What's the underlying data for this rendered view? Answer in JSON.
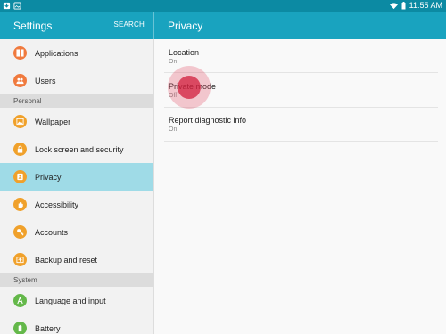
{
  "status_bar": {
    "time": "11:55 AM",
    "icons": [
      "download-icon",
      "image-icon",
      "wifi-icon",
      "battery-icon"
    ]
  },
  "header": {
    "title": "Settings",
    "search_label": "SEARCH",
    "detail_title": "Privacy"
  },
  "sidebar": {
    "items": [
      {
        "label": "Applications",
        "icon": "apps-icon",
        "color": "#f07a3e"
      },
      {
        "label": "Users",
        "icon": "users-icon",
        "color": "#f07a3e"
      }
    ],
    "personal_label": "Personal",
    "personal_items": [
      {
        "label": "Wallpaper",
        "icon": "wallpaper-icon",
        "color": "#f0a12b"
      },
      {
        "label": "Lock screen and security",
        "icon": "lock-icon",
        "color": "#f0a12b"
      },
      {
        "label": "Privacy",
        "icon": "privacy-icon",
        "color": "#f0a12b",
        "selected": true
      },
      {
        "label": "Accessibility",
        "icon": "hand-icon",
        "color": "#f0a12b"
      },
      {
        "label": "Accounts",
        "icon": "key-icon",
        "color": "#f0a12b"
      },
      {
        "label": "Backup and reset",
        "icon": "backup-icon",
        "color": "#f0a12b"
      }
    ],
    "system_label": "System",
    "system_items": [
      {
        "label": "Language and input",
        "icon": "language-icon",
        "color": "#64b84a"
      },
      {
        "label": "Battery",
        "icon": "battery-settings-icon",
        "color": "#64b84a"
      }
    ]
  },
  "privacy": {
    "rows": [
      {
        "title": "Location",
        "value": "On"
      },
      {
        "title": "Private mode",
        "value": "Off"
      },
      {
        "title": "Report diagnostic info",
        "value": "On"
      }
    ]
  },
  "colors": {
    "header": "#19a3bf",
    "status_bar": "#0c8aa3",
    "selected_row": "#9fdbe7",
    "touch_indicator": "#d21e3c"
  }
}
